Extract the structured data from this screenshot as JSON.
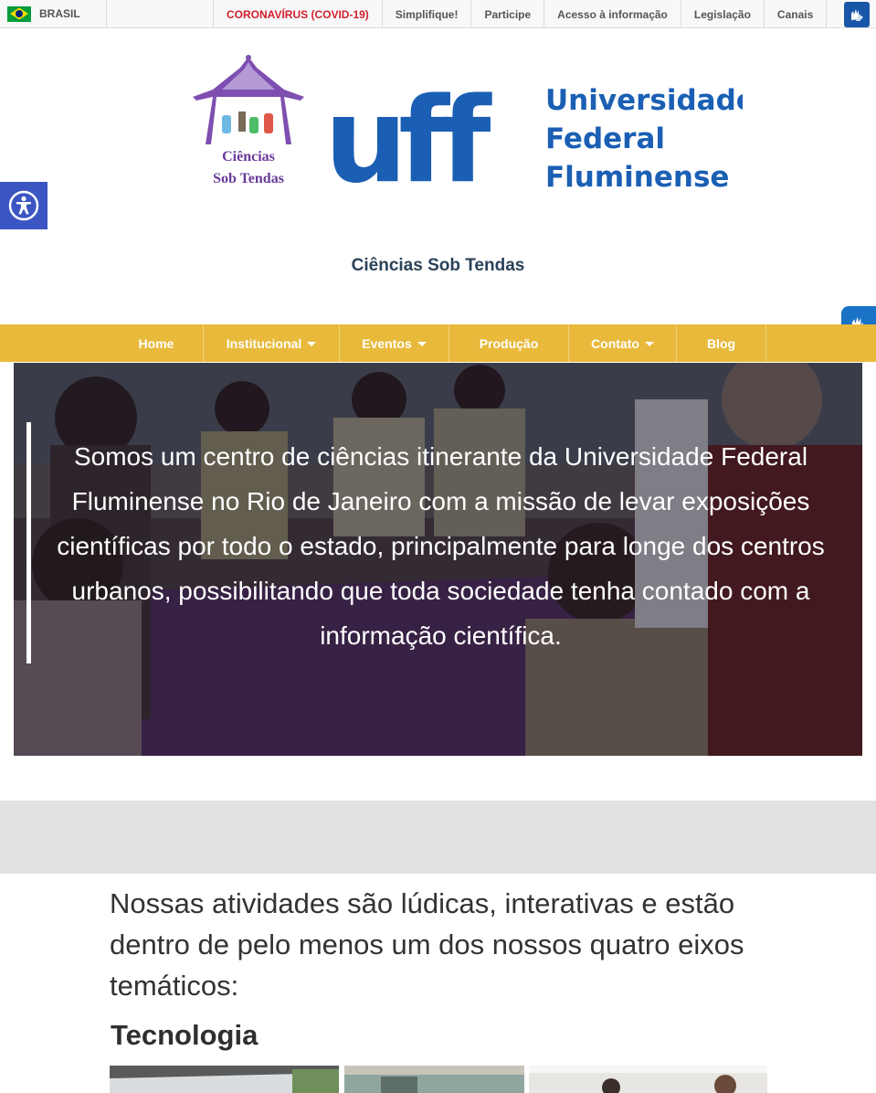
{
  "govbar": {
    "brasil": "BRASIL",
    "links": [
      {
        "label": "CORONAVÍRUS (COVID-19)"
      },
      {
        "label": "Simplifique!"
      },
      {
        "label": "Participe"
      },
      {
        "label": "Acesso à informação"
      },
      {
        "label": "Legislação"
      },
      {
        "label": "Canais"
      }
    ],
    "accent_red": "#d0202e"
  },
  "header": {
    "logo_cst": {
      "line1": "Ciências",
      "line2": "Sob Tendas"
    },
    "logo_uff": {
      "mark": "uff",
      "line1": "Universidade",
      "line2": "Federal",
      "line3": "Fluminense"
    },
    "site_title": "Ciências Sob Tendas"
  },
  "nav": {
    "color": "#e8b93b",
    "items": [
      {
        "label": "Home",
        "dropdown": false
      },
      {
        "label": "Institucional",
        "dropdown": true
      },
      {
        "label": "Eventos",
        "dropdown": true
      },
      {
        "label": "Produção",
        "dropdown": false
      },
      {
        "label": "Contato",
        "dropdown": true
      },
      {
        "label": "Blog",
        "dropdown": false
      }
    ]
  },
  "hero": {
    "text": "Somos um centro de ciências itinerante da Universidade Federal Fluminense no Rio de Janeiro com a missão de levar exposições científicas por todo o estado, principalmente para longe dos centros urbanos, possibilitando que toda sociedade tenha contado com a informação científica."
  },
  "content": {
    "intro": "Nossas atividades são lúdicas, interativas e estão dentro de pelo menos um dos nossos quatro eixos temáticos:",
    "section_heading": "Tecnologia"
  },
  "icons": {
    "flag": "brazil-flag-icon",
    "vlibras": "sign-language-hands-icon",
    "accessibility": "accessibility-person-icon"
  }
}
